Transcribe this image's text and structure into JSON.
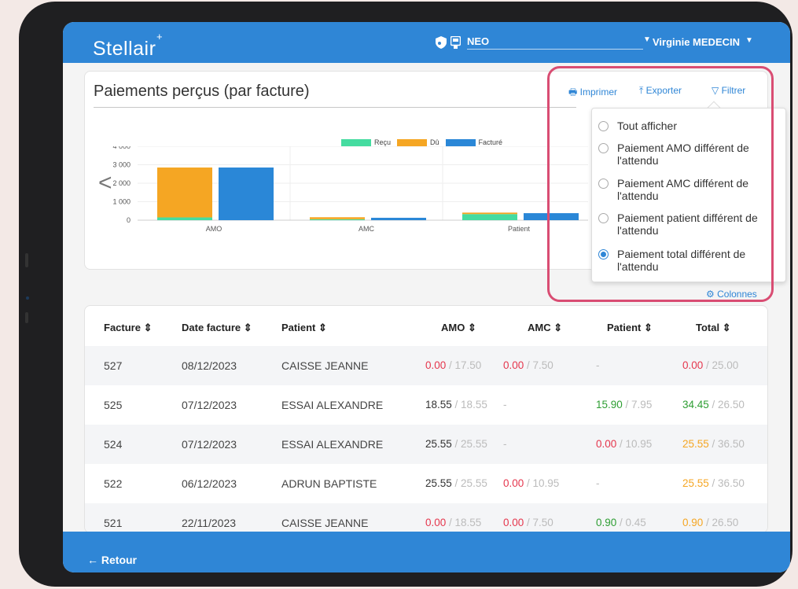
{
  "app": {
    "logo": "Stellair",
    "ps_name": "NEO",
    "user": "Virginie MEDECIN"
  },
  "page": {
    "title": "Paiements perçus (par facture)"
  },
  "actions": {
    "print": "Imprimer",
    "export": "Exporter",
    "filter": "Filtrer",
    "columns": "Colonnes"
  },
  "filter_options": [
    {
      "label": "Tout afficher",
      "selected": false
    },
    {
      "label": "Paiement AMO différent de l'attendu",
      "selected": false
    },
    {
      "label": "Paiement AMC différent de l'attendu",
      "selected": false
    },
    {
      "label": "Paiement patient différent de l'attendu",
      "selected": false
    },
    {
      "label": "Paiement total différent de l'attendu",
      "selected": true
    }
  ],
  "chart_data": {
    "type": "bar",
    "categories": [
      "AMO",
      "AMC",
      "Patient"
    ],
    "series": [
      {
        "name": "Reçu",
        "color": "#45dca0",
        "values": [
          150,
          50,
          330
        ]
      },
      {
        "name": "Dû",
        "color": "#f5a623",
        "values": [
          2700,
          110,
          80
        ]
      },
      {
        "name": "Facturé",
        "color": "#2a87d7",
        "values": [
          2850,
          130,
          380
        ]
      }
    ],
    "stacked_series": [
      "Reçu",
      "Dû"
    ],
    "ylim": [
      0,
      4000
    ],
    "yticks": [
      "4 000",
      "3 000",
      "2 000",
      "1 000",
      "0"
    ],
    "legend_placement": "top-center",
    "grid": true
  },
  "table": {
    "headers": [
      "Facture ⇕",
      "Date facture ⇕",
      "Patient ⇕",
      "AMO ⇕",
      "AMC ⇕",
      "Patient ⇕",
      "Total ⇕"
    ],
    "rows": [
      {
        "facture": "527",
        "date": "08/12/2023",
        "patient": "CAISSE JEANNE",
        "amo": "0.00",
        "amo_exp": " / 17.50",
        "amc": "0.00",
        "amc_exp": " / 7.50",
        "pat": "-",
        "pat_exp": "",
        "total": "0.00",
        "total_exp": " / 25.00"
      },
      {
        "facture": "525",
        "date": "07/12/2023",
        "patient": "ESSAI ALEXANDRE",
        "amo": "18.55",
        "amo_exp": " / 18.55",
        "amc": "-",
        "amc_exp": "",
        "pat": "15.90",
        "pat_exp": " / 7.95",
        "total": "34.45",
        "total_exp": " / 26.50"
      },
      {
        "facture": "524",
        "date": "07/12/2023",
        "patient": "ESSAI ALEXANDRE",
        "amo": "25.55",
        "amo_exp": " / 25.55",
        "amc": "-",
        "amc_exp": "",
        "pat": "0.00",
        "pat_exp": " / 10.95",
        "total": "25.55",
        "total_exp": " / 36.50"
      },
      {
        "facture": "522",
        "date": "06/12/2023",
        "patient": "ADRUN BAPTISTE",
        "amo": "25.55",
        "amo_exp": " / 25.55",
        "amc": "0.00",
        "amc_exp": " / 10.95",
        "pat": "-",
        "pat_exp": "",
        "total": "25.55",
        "total_exp": " / 36.50"
      },
      {
        "facture": "521",
        "date": "22/11/2023",
        "patient": "CAISSE JEANNE",
        "amo": "0.00",
        "amo_exp": " / 18.55",
        "amc": "0.00",
        "amc_exp": " / 7.50",
        "pat": "0.90",
        "pat_exp": " / 0.45",
        "total": "0.90",
        "total_exp": " / 26.50"
      }
    ]
  },
  "footer": {
    "back": "← Retour"
  }
}
